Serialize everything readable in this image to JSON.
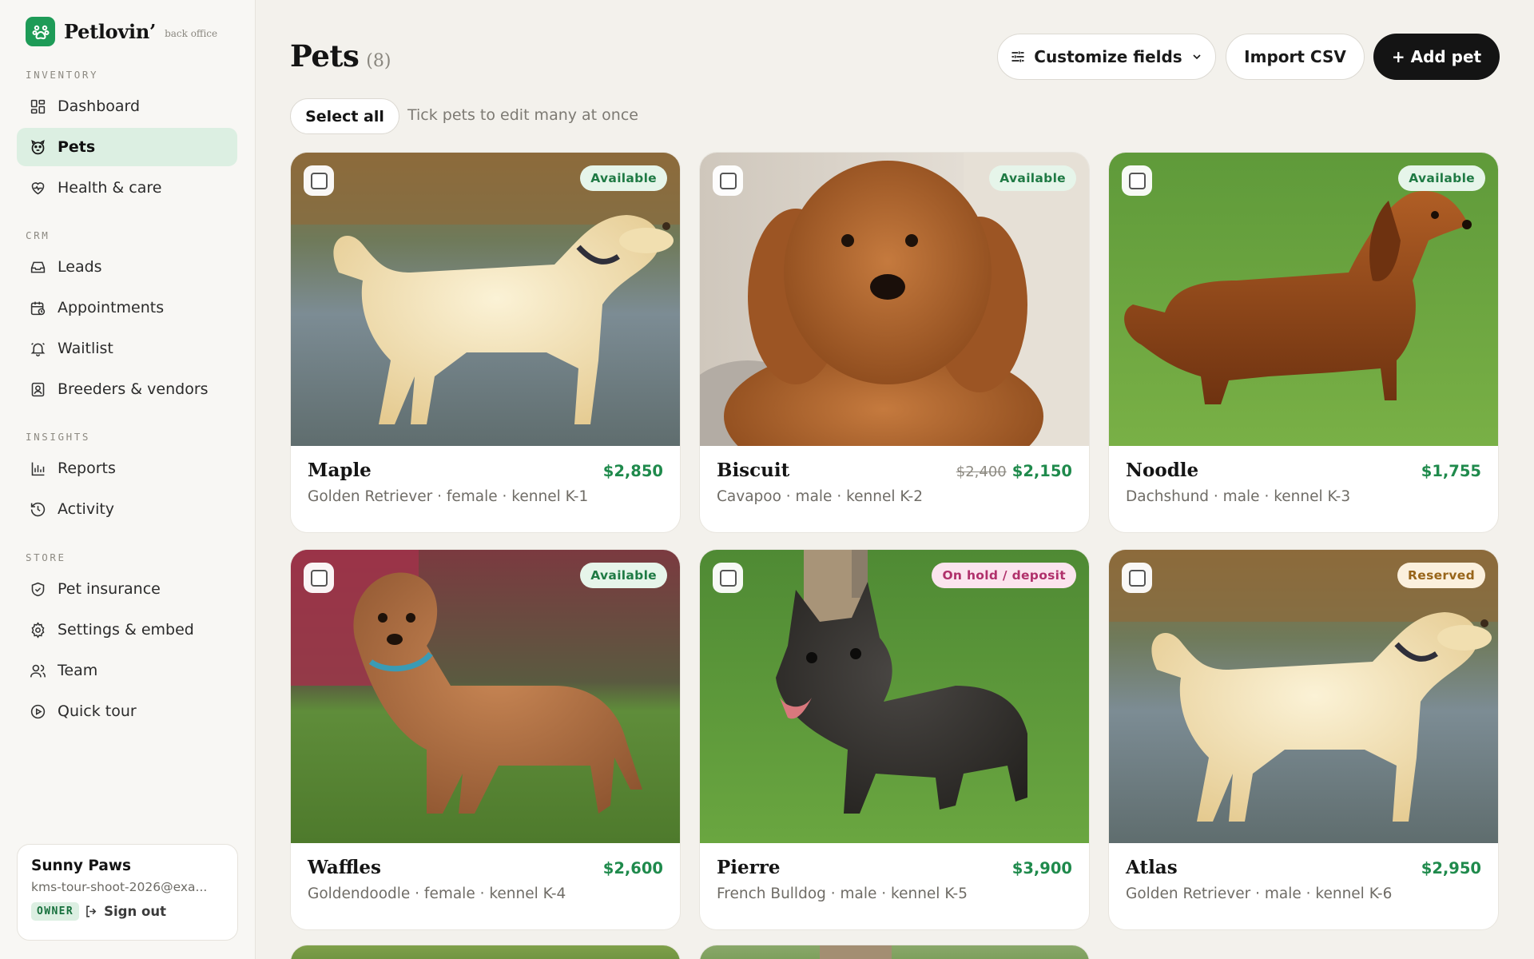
{
  "brand": {
    "name": "Petlovin’",
    "subtitle": "back office"
  },
  "sidebar": {
    "sections": [
      {
        "label": "INVENTORY",
        "items": [
          {
            "label": "Dashboard",
            "icon": "grid-icon"
          },
          {
            "label": "Pets",
            "icon": "paw-icon",
            "active": true
          },
          {
            "label": "Health & care",
            "icon": "heart-pulse-icon"
          }
        ]
      },
      {
        "label": "CRM",
        "items": [
          {
            "label": "Leads",
            "icon": "inbox-icon"
          },
          {
            "label": "Appointments",
            "icon": "calendar-clock-icon"
          },
          {
            "label": "Waitlist",
            "icon": "bell-icon"
          },
          {
            "label": "Breeders & vendors",
            "icon": "contact-book-icon"
          }
        ]
      },
      {
        "label": "INSIGHTS",
        "items": [
          {
            "label": "Reports",
            "icon": "bar-chart-icon"
          },
          {
            "label": "Activity",
            "icon": "history-icon"
          }
        ]
      },
      {
        "label": "STORE",
        "items": [
          {
            "label": "Pet insurance",
            "icon": "shield-check-icon"
          },
          {
            "label": "Settings & embed",
            "icon": "gear-icon"
          },
          {
            "label": "Team",
            "icon": "users-icon"
          },
          {
            "label": "Quick tour",
            "icon": "play-circle-icon"
          }
        ]
      }
    ]
  },
  "user": {
    "name": "Sunny Paws",
    "email": "kms-tour-shoot-2026@exa...",
    "role": "OWNER",
    "signout_label": "Sign out"
  },
  "header": {
    "title": "Pets",
    "count": "(8)",
    "customize_label": "Customize fields",
    "import_label": "Import CSV",
    "add_label": "+ Add pet"
  },
  "selection": {
    "select_all_label": "Select all",
    "hint": "Tick pets to edit many at once"
  },
  "pets": [
    {
      "name": "Maple",
      "breed": "Golden Retriever",
      "sex": "female",
      "kennel": "kennel K-1",
      "meta": "Golden Retriever · female · kennel K-1",
      "price": "$2,850",
      "old_price": "",
      "status": "Available",
      "status_kind": "available",
      "photo": "golden"
    },
    {
      "name": "Biscuit",
      "breed": "Cavapoo",
      "sex": "male",
      "kennel": "kennel K-2",
      "meta": "Cavapoo · male · kennel K-2",
      "price": "$2,150",
      "old_price": "$2,400",
      "status": "Available",
      "status_kind": "available",
      "photo": "cavapoo"
    },
    {
      "name": "Noodle",
      "breed": "Dachshund",
      "sex": "male",
      "kennel": "kennel K-3",
      "meta": "Dachshund · male · kennel K-3",
      "price": "$1,755",
      "old_price": "",
      "status": "Available",
      "status_kind": "available",
      "photo": "dachshund"
    },
    {
      "name": "Waffles",
      "breed": "Goldendoodle",
      "sex": "female",
      "kennel": "kennel K-4",
      "meta": "Goldendoodle · female · kennel K-4",
      "price": "$2,600",
      "old_price": "",
      "status": "Available",
      "status_kind": "available",
      "photo": "doodle"
    },
    {
      "name": "Pierre",
      "breed": "French Bulldog",
      "sex": "male",
      "kennel": "kennel K-5",
      "meta": "French Bulldog · male · kennel K-5",
      "price": "$3,900",
      "old_price": "",
      "status": "On hold / deposit",
      "status_kind": "hold",
      "photo": "frenchie"
    },
    {
      "name": "Atlas",
      "breed": "Golden Retriever",
      "sex": "male",
      "kennel": "kennel K-6",
      "meta": "Golden Retriever · male · kennel K-6",
      "price": "$2,950",
      "old_price": "",
      "status": "Reserved",
      "status_kind": "reserved",
      "photo": "golden"
    }
  ],
  "colors": {
    "brand_green": "#1e9b57",
    "price_green": "#1f8a4c",
    "active_nav_bg": "#dcefe2",
    "page_bg": "#f3f1ec",
    "dark_button": "#141414"
  }
}
